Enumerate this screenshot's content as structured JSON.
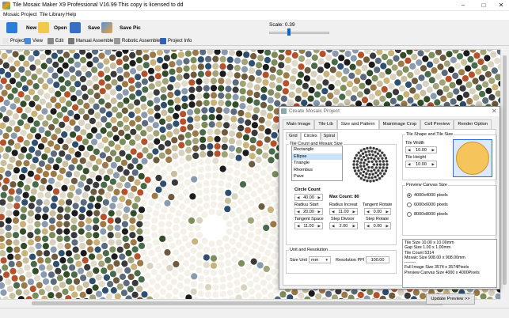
{
  "window": {
    "title": "Tile Mosaic Maker X9 Professional V16.99   This copy is licensed to dd"
  },
  "menu": [
    "Mosaic Project",
    "Tile Library",
    "Help"
  ],
  "toolbar": {
    "new": "New",
    "open": "Open",
    "save": "Save",
    "save_pic": "Save Pic",
    "scale_label": "Scale: 0.39",
    "scale_value": 0.39
  },
  "toolbar2": [
    "Project",
    "View",
    "Edit",
    "Manual Assemble",
    "Robotic Assemble",
    "Project Info"
  ],
  "dialog": {
    "title": "Create Mosaic Project",
    "tabs": [
      "Main Image",
      "Tile Lib",
      "Size and Pattern",
      "Mainimage Crop",
      "Cell Preview",
      "Render Option"
    ],
    "active_tab": "Size and Pattern",
    "subtabs": [
      "Grid",
      "Circles",
      "Spiral"
    ],
    "active_subtab": "Circles",
    "group_tile_count": "Tile Count and Mosaic Size",
    "shape_list": [
      "Rectangle",
      "Ellipse",
      "Triangle",
      "Rhombus",
      "Pave"
    ],
    "shape_selected": "Ellipse",
    "circle_count_label": "Circle Count",
    "circle_count": "40.00",
    "max_count": "Max Count: 80",
    "radius_start_label": "Radiuu Start",
    "radius_start": "20.00",
    "radius_increat_label": "Radius Increat",
    "radius_increat": "11.00",
    "tangent_rotate_label": "Tangent Rotate",
    "tangent_rotate": "0.00",
    "tangent_space_label": "Tangent Space",
    "tangent_space": "11.00",
    "step_divisor_label": "Step Divisor",
    "step_divisor": "2.00",
    "step_rotate_label": "Step Rotate",
    "step_rotate": "0.00",
    "unit_group": "Unit and Resolution",
    "size_unit_label": "Size Unit",
    "size_unit": "mm",
    "resolution_label": "Resolution PPI",
    "resolution": "100.00",
    "tile_shape_group": "Tile Shape and Tile Size",
    "tile_width_label": "Tile Width",
    "tile_width": "10.00",
    "tile_height_label": "Tile Height",
    "tile_height": "10.00",
    "preview_group": "Preview Canvas Size",
    "preview_options": [
      "4000x4000 pixels",
      "6000x6000 pixels",
      "8000x8000 pixels"
    ],
    "preview_selected": "4000x4000 pixels",
    "info_lines": [
      "Tile Size 10.00 x 10.00mm",
      "Gap Size 1.00 x 1.00mm",
      "Tile Count 5314",
      "Mosaic Size 908.00 x 908.00mm",
      "--------",
      "Full Image Size 3574 x 3574Pixels",
      "Preview Canvas Size 4000 x 4000Pixels"
    ],
    "update_button": "Update Preview >>"
  },
  "colors": {
    "accent": "#0a64d2",
    "tile_fill": "#f5c45a",
    "tile_stroke": "#2a6fd6"
  }
}
